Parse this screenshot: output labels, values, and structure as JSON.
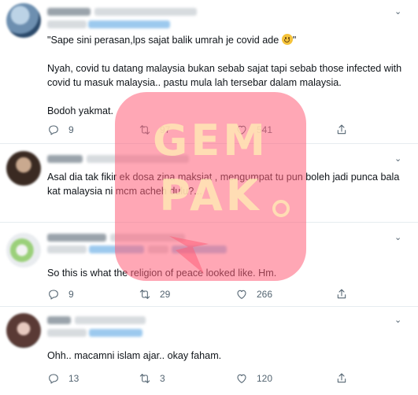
{
  "tweets": [
    {
      "text_line1": "\"Sape sini perasan,lps sajat balik umrah je covid ade ",
      "text_line1_end": "\"",
      "text_rest": "Nyah, covid tu datang malaysia bukan sebab sajat tapi sebab those infected with covid tu masuk malaysia.. pastu mula lah tersebar dalam malaysia.\n\nBodoh yakmat.",
      "replies": "9",
      "retweets": "97",
      "likes": "541"
    },
    {
      "text": "Asal dia tak fikir ek dosa zina maksiat , mengumpat tu pun boleh jadi punca bala kat malaysia ni mcm acheh dulu?..."
    },
    {
      "text": "So this is what the religion of peace looked like. Hm.",
      "replies": "9",
      "retweets": "29",
      "likes": "266"
    },
    {
      "text": "Ohh.. macamni islam ajar.. okay faham.",
      "replies": "13",
      "retweets": "3",
      "likes": "120"
    }
  ],
  "watermark": {
    "line1": "GEM",
    "line2": "PAK"
  },
  "icons": [
    "reply-icon",
    "retweet-icon",
    "like-icon",
    "share-icon",
    "more-caret-icon",
    "smiling-face-emoji"
  ],
  "colors": {
    "text": "#0f1419",
    "muted": "#536471",
    "divider": "#e6ecf0",
    "watermark": "#ff5f78"
  }
}
